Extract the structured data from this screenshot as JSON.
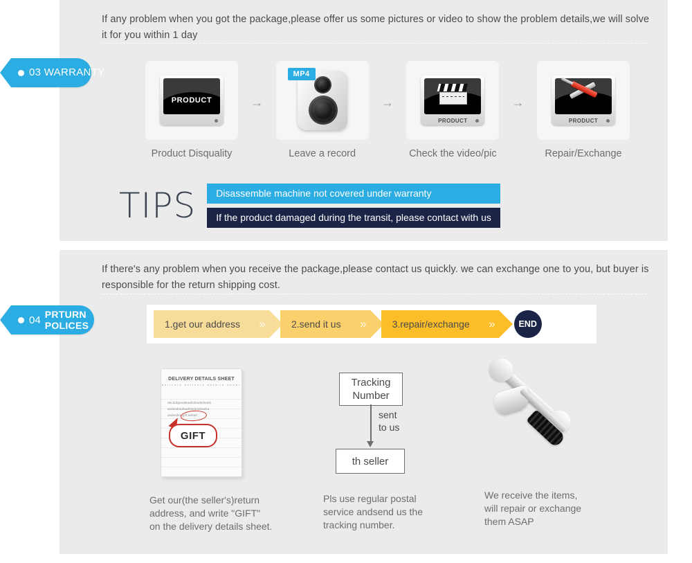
{
  "colors": {
    "panel_bg": "#ebebeb",
    "page_bg": "#ffffff",
    "tag_blue": "#2bace2",
    "tip_blue": "#2bace2",
    "tip_navy": "#1b2446",
    "chevron_1": "#f8dd9a",
    "chevron_2": "#fad06c",
    "chevron_3": "#fbbe28",
    "end_badge": "#1b2446",
    "callout_red": "#c8302a",
    "body_text": "#6d6d6d"
  },
  "warranty": {
    "tag": {
      "number": "03",
      "label": "WARRANTY",
      "bullet_icon": "dot-icon"
    },
    "intro": "If any problem when you got the package,please offer us some pictures or video to show the problem details,we will solve it for you within 1 day",
    "steps": [
      {
        "icon": "monitor-product-icon",
        "screen_text": "PRODUCT",
        "caption": "Product Disquality"
      },
      {
        "icon": "mp4-recorder-icon",
        "badge": "MP4",
        "caption": "Leave a record"
      },
      {
        "icon": "monitor-clapperboard-icon",
        "base_text": "PRODUCT",
        "caption": "Check the video/pic"
      },
      {
        "icon": "monitor-tools-icon",
        "base_text": "PRODUCT",
        "caption": "Repair/Exchange"
      }
    ],
    "arrow_glyph": "→",
    "tips": {
      "heading": "TIPS",
      "bars": [
        "Disassemble machine not covered under warranty",
        "If the product damaged during the transit, please contact with us"
      ]
    }
  },
  "returns": {
    "tag": {
      "number": "04",
      "label": "PRTURN\nPOLICES",
      "bullet_icon": "dot-icon"
    },
    "intro": "If  there's any problem when you receive the package,please contact us quickly. we can exchange one to you, but buyer is responsible for the return shipping cost.",
    "flow": {
      "steps": [
        "1.get our address",
        "2.send it us",
        "3.repair/exchange"
      ],
      "end_label": "END",
      "chevron_glyph": "»"
    },
    "columns": [
      {
        "illustration": "delivery-details-sheet",
        "sheet": {
          "header": "DELIVERY DETAILS SHEET",
          "subheader": "delivery        delivery details sheet",
          "body_lines": [
            "abcdafgasddsadcdsadsdsads",
            "asdasdsadsadfasdasdsadsa",
            "asdasdsa     gift  adsad"
          ],
          "callout": "GIFT"
        },
        "caption": "Get our(the seller's)return\naddress, and write \"GIFT\"\non the delivery details sheet."
      },
      {
        "illustration": "tracking-number-flow",
        "flow": {
          "top_box": "Tracking\nNumber",
          "arrow_label": "sent\nto us",
          "bottom_box": "th seller"
        },
        "caption": "Pls use regular postal\nservice andsend us the\n tracking number."
      },
      {
        "illustration": "hammer-wrench-tools",
        "caption": "We receive the items,\nwill repair or exchange\n them ASAP"
      }
    ]
  }
}
